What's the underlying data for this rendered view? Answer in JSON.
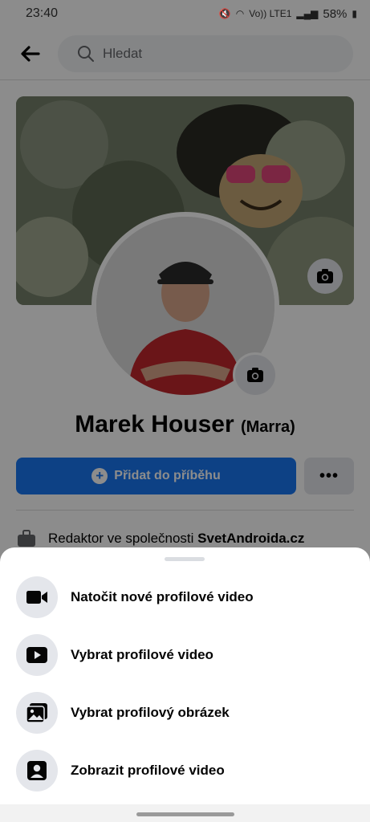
{
  "status_bar": {
    "time": "23:40",
    "network": "Vo)) LTE1",
    "battery": "58%"
  },
  "topbar": {
    "search_placeholder": "Hledat"
  },
  "profile": {
    "name": "Marek Houser",
    "alternate_name": "(Marra)",
    "add_story_label": "Přidat do příběhu",
    "more_label": "•••",
    "work_prefix": "Redaktor ve společnosti ",
    "work_company": "SvetAndroida.cz"
  },
  "sheet": {
    "items": [
      {
        "label": "Natočit nové profilové video",
        "icon": "video-camera-icon"
      },
      {
        "label": "Vybrat profilové video",
        "icon": "play-video-icon"
      },
      {
        "label": "Vybrat profilový obrázek",
        "icon": "photo-gallery-icon"
      },
      {
        "label": "Zobrazit profilové video",
        "icon": "person-portrait-icon"
      }
    ]
  },
  "colors": {
    "accent": "#1877f2",
    "overlay": "rgba(0,0,0,0.45)",
    "icon_bg": "#e4e6eb"
  }
}
